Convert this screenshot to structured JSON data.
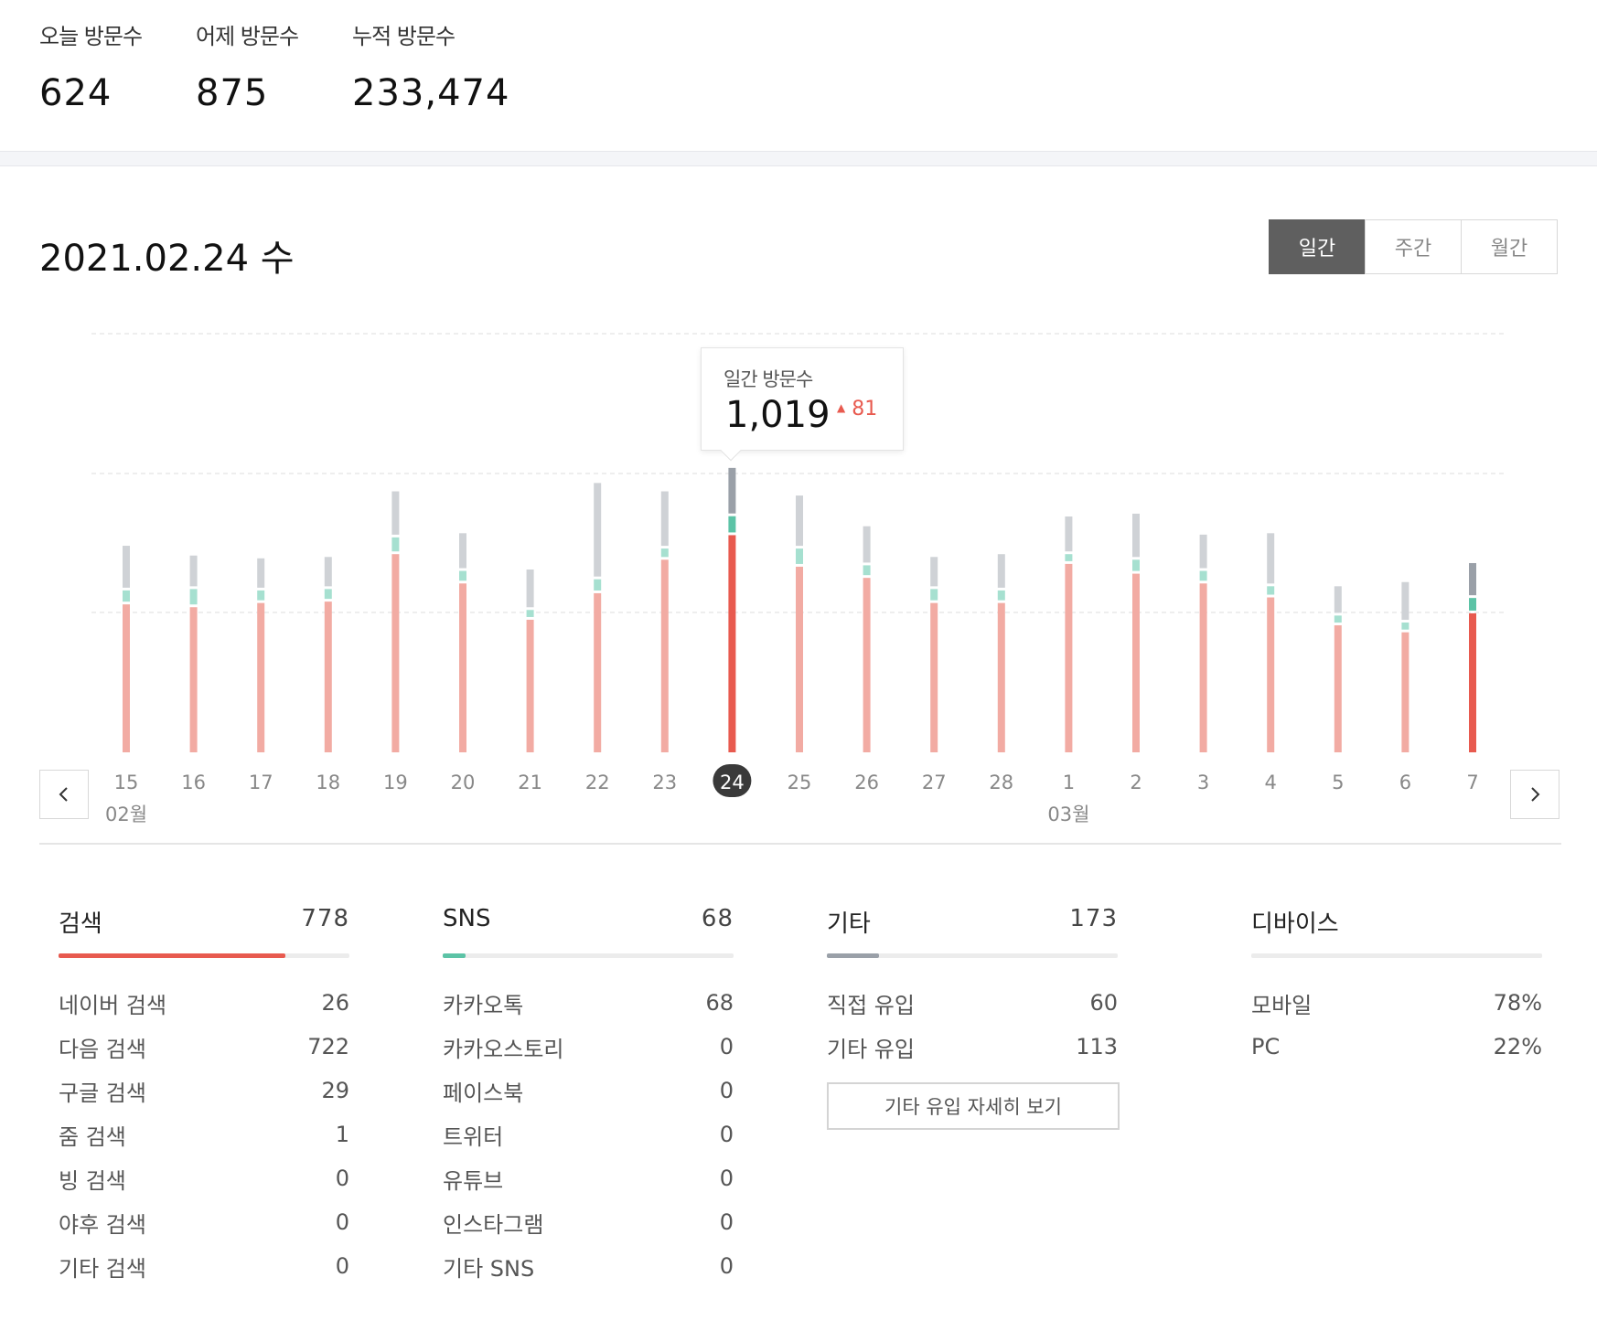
{
  "summary": {
    "today_label": "오늘 방문수",
    "today_value": "624",
    "yesterday_label": "어제 방문수",
    "yesterday_value": "875",
    "total_label": "누적 방문수",
    "total_value": "233,474"
  },
  "header": {
    "date_title": "2021.02.24 수",
    "tabs": [
      {
        "label": "일간",
        "active": true
      },
      {
        "label": "주간",
        "active": false
      },
      {
        "label": "월간",
        "active": false
      }
    ]
  },
  "tooltip": {
    "title": "일간 방문수",
    "value": "1,019",
    "delta": "81"
  },
  "colors": {
    "search": "#e85a4f",
    "search_light": "#f2aba3",
    "sns": "#5cc3a6",
    "sns_light": "#a6e0d0",
    "etc": "#9aa0a8",
    "etc_light": "#cfd2d6",
    "selected_badge": "#3a3a3a"
  },
  "chart_data": {
    "type": "bar",
    "stacked": true,
    "categories": [
      "15",
      "16",
      "17",
      "18",
      "19",
      "20",
      "21",
      "22",
      "23",
      "24",
      "25",
      "26",
      "27",
      "28",
      "1",
      "2",
      "3",
      "4",
      "5",
      "6",
      "7"
    ],
    "month_labels": [
      {
        "at": "15",
        "label": "02월"
      },
      {
        "at": "1",
        "label": "03월"
      }
    ],
    "selected": "24",
    "highlighted": [
      "24",
      "7"
    ],
    "series": [
      {
        "key": "search",
        "values": [
          530,
          520,
          535,
          540,
          710,
          605,
          475,
          570,
          690,
          778,
          665,
          625,
          535,
          535,
          675,
          640,
          605,
          555,
          455,
          430,
          498
        ]
      },
      {
        "key": "sns",
        "values": [
          50,
          65,
          45,
          45,
          60,
          45,
          35,
          50,
          40,
          68,
          65,
          45,
          50,
          45,
          35,
          50,
          45,
          40,
          35,
          35,
          55
        ]
      },
      {
        "key": "etc",
        "values": [
          160,
          120,
          115,
          115,
          165,
          135,
          145,
          345,
          205,
          173,
          190,
          140,
          115,
          130,
          135,
          165,
          130,
          190,
          105,
          145,
          125
        ]
      }
    ],
    "ylim": [
      0,
      1500
    ],
    "grid": true
  },
  "stats": {
    "search": {
      "title": "검색",
      "total": "778",
      "fill_ratio": 0.78,
      "rows": [
        {
          "label": "네이버 검색",
          "value": "26"
        },
        {
          "label": "다음 검색",
          "value": "722"
        },
        {
          "label": "구글 검색",
          "value": "29"
        },
        {
          "label": "줌 검색",
          "value": "1"
        },
        {
          "label": "빙 검색",
          "value": "0"
        },
        {
          "label": "야후 검색",
          "value": "0"
        },
        {
          "label": "기타 검색",
          "value": "0"
        }
      ]
    },
    "sns": {
      "title": "SNS",
      "total": "68",
      "fill_ratio": 0.08,
      "rows": [
        {
          "label": "카카오톡",
          "value": "68"
        },
        {
          "label": "카카오스토리",
          "value": "0"
        },
        {
          "label": "페이스북",
          "value": "0"
        },
        {
          "label": "트위터",
          "value": "0"
        },
        {
          "label": "유튜브",
          "value": "0"
        },
        {
          "label": "인스타그램",
          "value": "0"
        },
        {
          "label": "기타 SNS",
          "value": "0"
        }
      ]
    },
    "etc": {
      "title": "기타",
      "total": "173",
      "fill_ratio": 0.18,
      "rows": [
        {
          "label": "직접 유입",
          "value": "60"
        },
        {
          "label": "기타 유입",
          "value": "113"
        }
      ],
      "detail_button": "기타 유입 자세히 보기"
    },
    "device": {
      "title": "디바이스",
      "rows": [
        {
          "label": "모바일",
          "value": "78%"
        },
        {
          "label": "PC",
          "value": "22%"
        }
      ]
    }
  }
}
